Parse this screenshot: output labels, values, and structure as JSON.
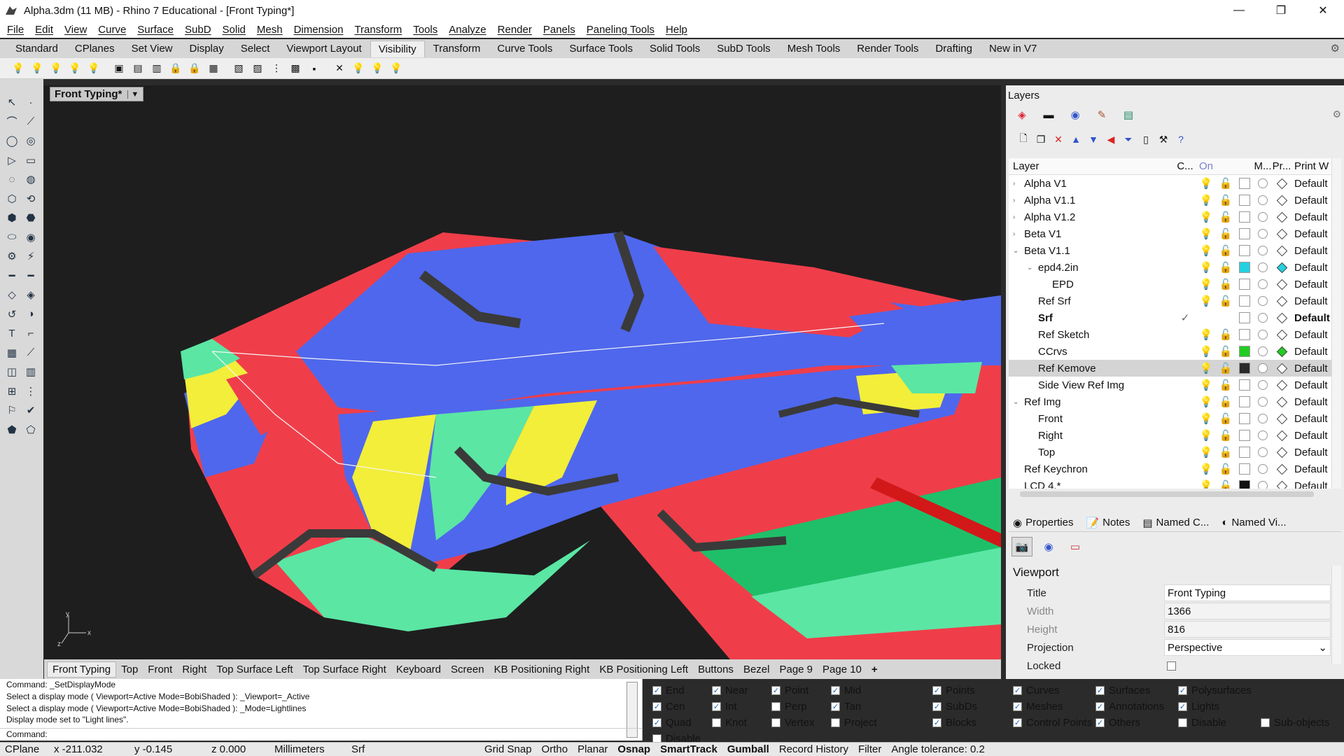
{
  "window": {
    "title": "Alpha.3dm (11 MB) - Rhino 7 Educational - [Front Typing*]"
  },
  "menu": [
    "File",
    "Edit",
    "View",
    "Curve",
    "Surface",
    "SubD",
    "Solid",
    "Mesh",
    "Dimension",
    "Transform",
    "Tools",
    "Analyze",
    "Render",
    "Panels",
    "Paneling Tools",
    "Help"
  ],
  "tabs": [
    "Standard",
    "CPlanes",
    "Set View",
    "Display",
    "Select",
    "Viewport Layout",
    "Visibility",
    "Transform",
    "Curve Tools",
    "Surface Tools",
    "Solid Tools",
    "SubD Tools",
    "Mesh Tools",
    "Render Tools",
    "Drafting",
    "New in V7"
  ],
  "active_tab": "Visibility",
  "viewport": {
    "label": "Front Typing*"
  },
  "viewport_tabs": [
    "Front Typing",
    "Top",
    "Front",
    "Right",
    "Top Surface Left",
    "Top Surface Right",
    "Keyboard",
    "Screen",
    "KB Positioning Right",
    "KB Positioning Left",
    "Buttons",
    "Bezel",
    "Page 9",
    "Page 10",
    "+"
  ],
  "command_history": [
    "Command: _SetDisplayMode",
    "Select a display mode ( Viewport=Active  Mode=BobiShaded ): _Viewport=_Active",
    "Select a display mode ( Viewport=Active  Mode=BobiShaded ): _Mode=Lightlines",
    "Display mode set to \"Light lines\"."
  ],
  "command_prompt": "Command:",
  "osnaps": [
    {
      "label": "End",
      "checked": true
    },
    {
      "label": "Near",
      "checked": true
    },
    {
      "label": "Point",
      "checked": true
    },
    {
      "label": "Mid",
      "checked": true
    },
    {
      "label": "Cen",
      "checked": true
    },
    {
      "label": "Int",
      "checked": true
    },
    {
      "label": "Perp",
      "checked": false
    },
    {
      "label": "Tan",
      "checked": true
    },
    {
      "label": "Quad",
      "checked": true
    },
    {
      "label": "Knot",
      "checked": false
    },
    {
      "label": "Vertex",
      "checked": false
    },
    {
      "label": "Project",
      "checked": false
    },
    {
      "label": "Disable",
      "checked": false
    }
  ],
  "filters": [
    {
      "label": "Points",
      "checked": true
    },
    {
      "label": "Curves",
      "checked": true
    },
    {
      "label": "Surfaces",
      "checked": true
    },
    {
      "label": "Polysurfaces",
      "checked": true
    },
    {
      "label": "",
      "checked": null
    },
    {
      "label": "SubDs",
      "checked": true
    },
    {
      "label": "Meshes",
      "checked": true
    },
    {
      "label": "Annotations",
      "checked": true
    },
    {
      "label": "Lights",
      "checked": true
    },
    {
      "label": "",
      "checked": null
    },
    {
      "label": "Blocks",
      "checked": true
    },
    {
      "label": "Control Points",
      "checked": true
    },
    {
      "label": "Others",
      "checked": true
    },
    {
      "label": "Disable",
      "checked": false
    },
    {
      "label": "Sub-objects",
      "checked": false
    }
  ],
  "status": {
    "cplane": "CPlane",
    "x": "x -211.032",
    "y": "y -0.145",
    "z": "z 0.000",
    "units": "Millimeters",
    "layer": "Srf",
    "toggles": [
      {
        "label": "Grid Snap",
        "bold": false
      },
      {
        "label": "Ortho",
        "bold": false
      },
      {
        "label": "Planar",
        "bold": false
      },
      {
        "label": "Osnap",
        "bold": true
      },
      {
        "label": "SmartTrack",
        "bold": true
      },
      {
        "label": "Gumball",
        "bold": true
      },
      {
        "label": "Record History",
        "bold": false
      },
      {
        "label": "Filter",
        "bold": false
      }
    ],
    "tolerance": "Angle tolerance: 0.2"
  },
  "layers_panel": {
    "title": "Layers",
    "columns": [
      "Layer",
      "C...",
      "On",
      "",
      "",
      "M...",
      "Pr...",
      "Print W"
    ],
    "rows": [
      {
        "name": "Alpha V1",
        "indent": 0,
        "expand": "›",
        "color": "#ffffff",
        "pw": "Default",
        "bold": false,
        "current": false,
        "sel": false,
        "bulb": "#7a7fd0",
        "lock": "#c89a00"
      },
      {
        "name": "Alpha V1.1",
        "indent": 0,
        "expand": "›",
        "color": "#ffffff",
        "pw": "Default",
        "bold": false,
        "current": false,
        "sel": false,
        "bulb": "#7a7fd0",
        "lock": "#c89a00"
      },
      {
        "name": "Alpha V1.2",
        "indent": 0,
        "expand": "›",
        "color": "#ffffff",
        "pw": "Default",
        "bold": false,
        "current": false,
        "sel": false,
        "bulb": "#7a7fd0",
        "lock": "#c89a00"
      },
      {
        "name": "Beta V1",
        "indent": 0,
        "expand": "›",
        "color": "#ffffff",
        "pw": "Default",
        "bold": false,
        "current": false,
        "sel": false,
        "bulb": "#7a7fd0",
        "lock": "#c89a00"
      },
      {
        "name": "Beta V1.1",
        "indent": 0,
        "expand": "⌄",
        "color": "#ffffff",
        "pw": "Default",
        "bold": false,
        "current": false,
        "sel": false,
        "bulb": "#e6b800",
        "lock": "#c89a00"
      },
      {
        "name": "epd4.2in",
        "indent": 1,
        "expand": "⌄",
        "color": "#25d0e0",
        "pw": "Default",
        "bold": false,
        "current": false,
        "sel": false,
        "bulb": "#e6b800",
        "lock": "#c89a00"
      },
      {
        "name": "EPD",
        "indent": 2,
        "expand": "",
        "color": "#ffffff",
        "pw": "Default",
        "bold": false,
        "current": false,
        "sel": false,
        "bulb": "#e6b800",
        "lock": "#c89a00"
      },
      {
        "name": "Ref Srf",
        "indent": 1,
        "expand": "",
        "color": "#ffffff",
        "pw": "Default",
        "bold": false,
        "current": false,
        "sel": false,
        "bulb": "#7a7fd0",
        "lock": "#c89a00"
      },
      {
        "name": "Srf",
        "indent": 1,
        "expand": "",
        "color": "#ffffff",
        "pw": "Default",
        "bold": true,
        "current": true,
        "sel": false,
        "bulb": "",
        "lock": ""
      },
      {
        "name": "Ref Sketch",
        "indent": 1,
        "expand": "",
        "color": "#ffffff",
        "pw": "Default",
        "bold": false,
        "current": false,
        "sel": false,
        "bulb": "#7a7fd0",
        "lock": "#7a7fd0"
      },
      {
        "name": "CCrvs",
        "indent": 1,
        "expand": "",
        "color": "#22cc22",
        "pw": "Default",
        "bold": false,
        "current": false,
        "sel": false,
        "bulb": "#7a7fd0",
        "lock": "#c89a00"
      },
      {
        "name": "Ref Kemove",
        "indent": 1,
        "expand": "",
        "color": "#2a2a2a",
        "pw": "Default",
        "bold": false,
        "current": false,
        "sel": true,
        "bulb": "#e6b800",
        "lock": "#7a7fd0"
      },
      {
        "name": "Side View Ref Img",
        "indent": 1,
        "expand": "",
        "color": "#ffffff",
        "pw": "Default",
        "bold": false,
        "current": false,
        "sel": false,
        "bulb": "#7a7fd0",
        "lock": "#7a7fd0"
      },
      {
        "name": "Ref Img",
        "indent": 0,
        "expand": "⌄",
        "color": "#ffffff",
        "pw": "Default",
        "bold": false,
        "current": false,
        "sel": false,
        "bulb": "#7a7fd0",
        "lock": "#7a7fd0"
      },
      {
        "name": "Front",
        "indent": 1,
        "expand": "",
        "color": "#ffffff",
        "pw": "Default",
        "bold": false,
        "current": false,
        "sel": false,
        "bulb": "#7a7fd0",
        "lock": "#7a7fd0"
      },
      {
        "name": "Right",
        "indent": 1,
        "expand": "",
        "color": "#ffffff",
        "pw": "Default",
        "bold": false,
        "current": false,
        "sel": false,
        "bulb": "#7a7fd0",
        "lock": "#7a7fd0"
      },
      {
        "name": "Top",
        "indent": 1,
        "expand": "",
        "color": "#ffffff",
        "pw": "Default",
        "bold": false,
        "current": false,
        "sel": false,
        "bulb": "#7a7fd0",
        "lock": "#7a7fd0"
      },
      {
        "name": "Ref Keychron",
        "indent": 0,
        "expand": "",
        "color": "#ffffff",
        "pw": "Default",
        "bold": false,
        "current": false,
        "sel": false,
        "bulb": "#7a7fd0",
        "lock": "#c89a00"
      },
      {
        "name": "LCD 4.*",
        "indent": 0,
        "expand": "",
        "color": "#111111",
        "pw": "Default",
        "bold": false,
        "current": false,
        "sel": false,
        "bulb": "#7a7fd0",
        "lock": "#c89a00"
      }
    ]
  },
  "props_panel": {
    "tabs": [
      "Properties",
      "Notes",
      "Named C...",
      "Named Vi..."
    ],
    "section": "Viewport",
    "fields": [
      {
        "key": "Title",
        "value": "Front Typing",
        "dim": false
      },
      {
        "key": "Width",
        "value": "1366",
        "dim": true
      },
      {
        "key": "Height",
        "value": "816",
        "dim": true
      },
      {
        "key": "Projection",
        "value": "Perspective",
        "dim": false
      },
      {
        "key": "Locked",
        "value": "",
        "dim": false
      }
    ]
  },
  "colors": {
    "red": "#ef3e4a",
    "blue": "#4f67ec",
    "yellow": "#f2ee3a",
    "green": "#5be6a4",
    "dark": "#3a3a3a",
    "bg": "#1e1e1e"
  }
}
